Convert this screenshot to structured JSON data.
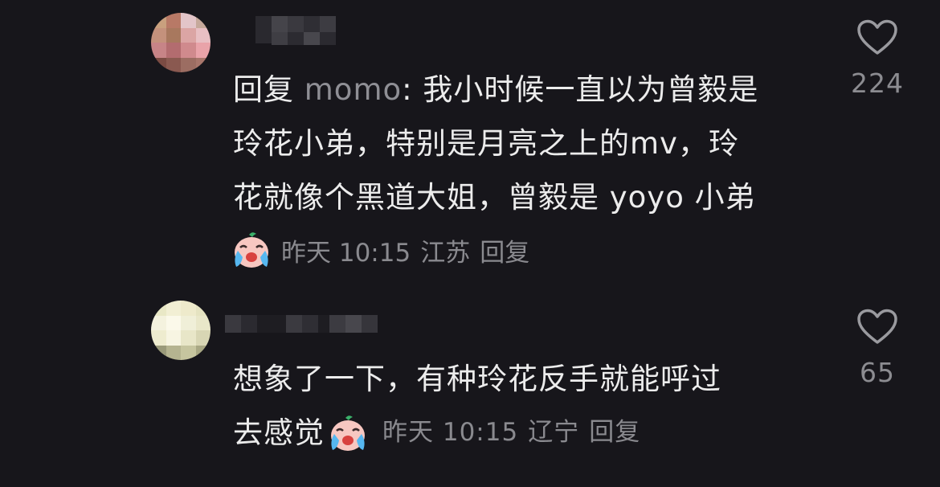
{
  "comments": [
    {
      "reply_prefix": "回复 ",
      "mention": "momo",
      "body_lines": [
        ": 我小时候一直以为曾毅是",
        "玲花小弟，特别是月亮之上的mv，玲",
        "花就像个黑道大姐，曾毅是 yoyo 小弟"
      ],
      "time": "昨天 10:15",
      "location": "江苏",
      "reply_label": "回复",
      "like_count": "224",
      "emoji": "crying-face-emoji"
    },
    {
      "body_lines": [
        "想象了一下，有种玲花反手就能呼过",
        "去感觉"
      ],
      "time": "昨天 10:15",
      "location": "辽宁",
      "reply_label": "回复",
      "like_count": "65",
      "emoji": "crying-face-emoji"
    }
  ],
  "colors": {
    "background": "#17161b",
    "text_primary": "#ececec",
    "text_secondary": "#8a8a8f",
    "heart_outline": "#9a9a9f"
  },
  "icons": [
    "heart-outline-icon"
  ]
}
